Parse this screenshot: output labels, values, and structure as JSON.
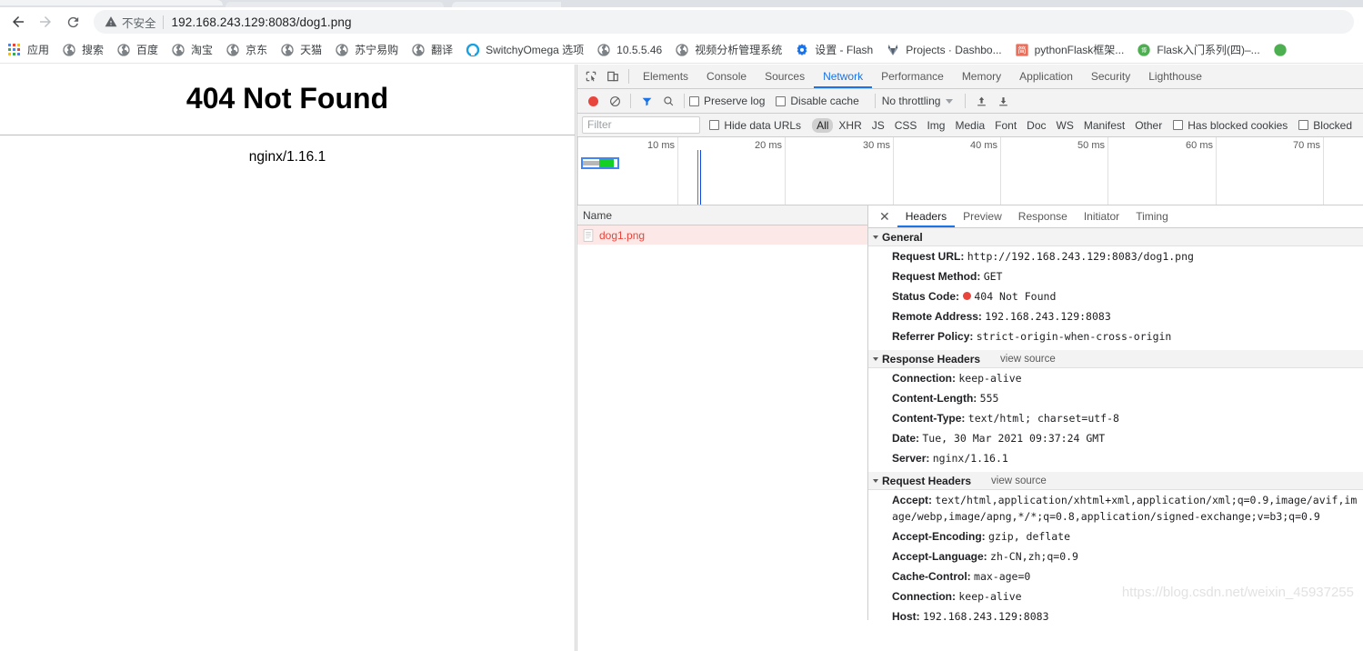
{
  "browser": {
    "back_icon": "back-arrow-icon",
    "forward_icon": "forward-arrow-icon",
    "reload_icon": "reload-icon",
    "security_warning_icon": "warning-triangle-icon",
    "security_label": "不安全",
    "url": "192.168.243.129:8083/dog1.png"
  },
  "bookmarks": [
    {
      "label": "应用",
      "icon": "apps-grid-icon"
    },
    {
      "label": "搜索",
      "icon": "globe-icon"
    },
    {
      "label": "百度",
      "icon": "globe-icon"
    },
    {
      "label": "淘宝",
      "icon": "globe-icon"
    },
    {
      "label": "京东",
      "icon": "globe-icon"
    },
    {
      "label": "天猫",
      "icon": "globe-icon"
    },
    {
      "label": "苏宁易购",
      "icon": "globe-icon"
    },
    {
      "label": "翻译",
      "icon": "globe-icon"
    },
    {
      "label": "SwitchyOmega 选项",
      "icon": "switchyomega-icon"
    },
    {
      "label": "10.5.5.46",
      "icon": "globe-icon"
    },
    {
      "label": "视频分析管理系统",
      "icon": "globe-icon"
    },
    {
      "label": "设置 - Flash",
      "icon": "flash-settings-icon"
    },
    {
      "label": "Projects · Dashbo...",
      "icon": "gitlab-icon"
    },
    {
      "label": "pythonFlask框架...",
      "icon": "jianshu-icon"
    },
    {
      "label": "Flask入门系列(四)–...",
      "icon": "cnblogs-icon"
    }
  ],
  "page": {
    "title": "404 Not Found",
    "server": "nginx/1.16.1"
  },
  "devtools": {
    "inspect_icon": "inspect-element-icon",
    "device_icon": "device-toolbar-icon",
    "tabs": [
      {
        "label": "Elements",
        "active": false
      },
      {
        "label": "Console",
        "active": false
      },
      {
        "label": "Sources",
        "active": false
      },
      {
        "label": "Network",
        "active": true
      },
      {
        "label": "Performance",
        "active": false
      },
      {
        "label": "Memory",
        "active": false
      },
      {
        "label": "Application",
        "active": false
      },
      {
        "label": "Security",
        "active": false
      },
      {
        "label": "Lighthouse",
        "active": false
      }
    ],
    "toolbar": {
      "record_icon": "record-button-icon",
      "clear_icon": "clear-icon",
      "filter_icon": "funnel-filter-icon",
      "search_icon": "search-icon",
      "preserve_log_label": "Preserve log",
      "preserve_log_checked": false,
      "disable_cache_label": "Disable cache",
      "disable_cache_checked": false,
      "throttling_value": "No throttling",
      "import_icon": "import-har-icon",
      "export_icon": "export-har-icon"
    },
    "filterbar": {
      "filter_placeholder": "Filter",
      "hide_data_urls_label": "Hide data URLs",
      "hide_data_urls_checked": false,
      "types": [
        "All",
        "XHR",
        "JS",
        "CSS",
        "Img",
        "Media",
        "Font",
        "Doc",
        "WS",
        "Manifest",
        "Other"
      ],
      "selected_type": "All",
      "has_blocked_cookies_label": "Has blocked cookies",
      "has_blocked_cookies_checked": false,
      "blocked_label": "Blocked",
      "blocked_checked": false
    },
    "overview": {
      "ticks": [
        "10 ms",
        "20 ms",
        "30 ms",
        "40 ms",
        "50 ms",
        "60 ms",
        "70 ms"
      ],
      "selection_color": "#4285f4",
      "wait_color": "#b7b7b7",
      "download_color": "#14d022",
      "dom_content_loaded_color": "#0d47d9",
      "load_event_color": "#e8453c"
    },
    "requests": {
      "column_header": "Name",
      "rows": [
        {
          "name": "dog1.png",
          "icon": "document-icon",
          "failed": true
        }
      ]
    },
    "detail": {
      "close_icon": "close-icon",
      "tabs": [
        {
          "label": "Headers",
          "active": true
        },
        {
          "label": "Preview",
          "active": false
        },
        {
          "label": "Response",
          "active": false
        },
        {
          "label": "Initiator",
          "active": false
        },
        {
          "label": "Timing",
          "active": false
        }
      ],
      "sections": [
        {
          "title": "General",
          "view_source": "",
          "rows": [
            {
              "key": "Request URL:",
              "value": "http://192.168.243.129:8083/dog1.png"
            },
            {
              "key": "Request Method:",
              "value": "GET"
            },
            {
              "key": "Status Code:",
              "value": "404 Not Found",
              "status_dot": true
            },
            {
              "key": "Remote Address:",
              "value": "192.168.243.129:8083"
            },
            {
              "key": "Referrer Policy:",
              "value": "strict-origin-when-cross-origin"
            }
          ]
        },
        {
          "title": "Response Headers",
          "view_source": "view source",
          "rows": [
            {
              "key": "Connection:",
              "value": "keep-alive"
            },
            {
              "key": "Content-Length:",
              "value": "555"
            },
            {
              "key": "Content-Type:",
              "value": "text/html; charset=utf-8"
            },
            {
              "key": "Date:",
              "value": "Tue, 30 Mar 2021 09:37:24 GMT"
            },
            {
              "key": "Server:",
              "value": "nginx/1.16.1"
            }
          ]
        },
        {
          "title": "Request Headers",
          "view_source": "view source",
          "rows": [
            {
              "key": "Accept:",
              "value": "text/html,application/xhtml+xml,application/xml;q=0.9,image/avif,image/webp,image/apng,*/*;q=0.8,application/signed-exchange;v=b3;q=0.9"
            },
            {
              "key": "Accept-Encoding:",
              "value": "gzip, deflate"
            },
            {
              "key": "Accept-Language:",
              "value": "zh-CN,zh;q=0.9"
            },
            {
              "key": "Cache-Control:",
              "value": "max-age=0"
            },
            {
              "key": "Connection:",
              "value": "keep-alive"
            },
            {
              "key": "Host:",
              "value": "192.168.243.129:8083"
            }
          ]
        }
      ]
    }
  },
  "watermark": "https://blog.csdn.net/weixin_45937255"
}
